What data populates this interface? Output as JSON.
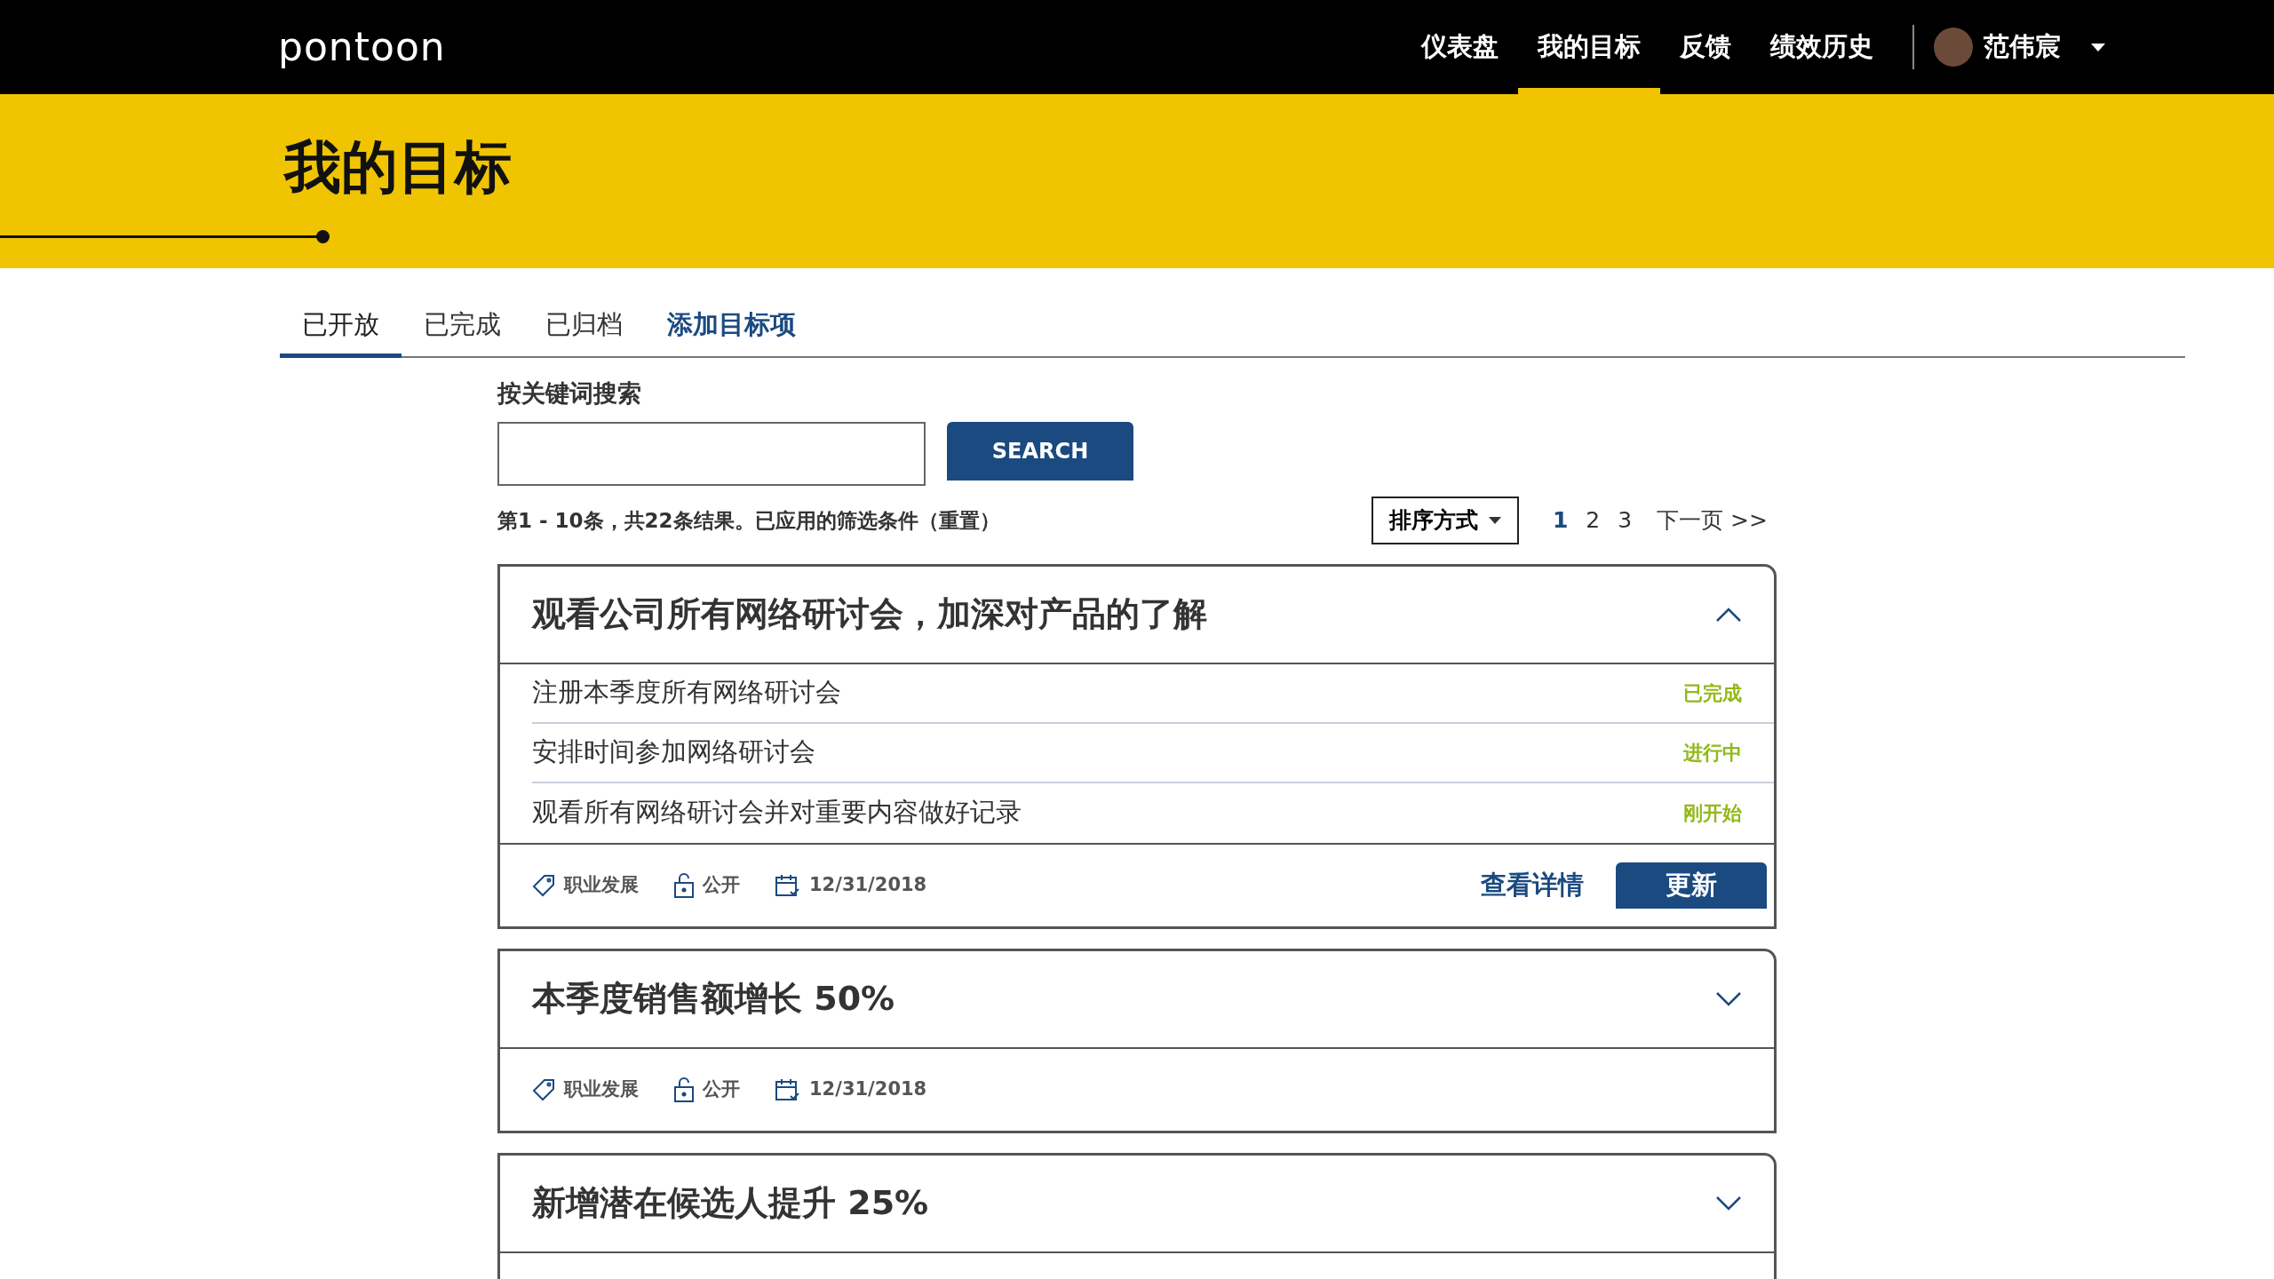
{
  "navbar": {
    "logo": "pontoon",
    "links": [
      {
        "label": "仪表盘",
        "selected": false
      },
      {
        "label": "我的目标",
        "selected": true
      },
      {
        "label": "反馈",
        "selected": false
      },
      {
        "label": "绩效历史",
        "selected": false
      }
    ],
    "user": {
      "name": "范伟宸"
    }
  },
  "page_title": "我的目标",
  "tabs": [
    {
      "label": "已开放",
      "selected": true,
      "kind": "tab"
    },
    {
      "label": "已完成",
      "selected": false,
      "kind": "tab"
    },
    {
      "label": "已归档",
      "selected": false,
      "kind": "tab"
    },
    {
      "label": "添加目标项",
      "selected": false,
      "kind": "action"
    }
  ],
  "search": {
    "label": "按关键词搜索",
    "button": "SEARCH"
  },
  "results_summary": "第1 - 10条，共22条结果。已应用的筛选条件（重置）",
  "sort": {
    "label": "排序方式"
  },
  "pagination": {
    "pages": [
      {
        "label": "1",
        "selected": true
      },
      {
        "label": "2",
        "selected": false
      },
      {
        "label": "3",
        "selected": false
      }
    ],
    "next": "下一页 >>"
  },
  "goals": [
    {
      "title": "观看公司所有网络研讨会，加深对产品的了解",
      "expanded": true,
      "subtasks": [
        {
          "title": "注册本季度所有网络研讨会",
          "status": "已完成"
        },
        {
          "title": "安排时间参加网络研讨会",
          "status": "进行中"
        },
        {
          "title": "观看所有网络研讨会并对重要内容做好记录",
          "status": "刚开始"
        }
      ],
      "meta": {
        "category": "职业发展",
        "visibility": "公开",
        "date": "12/31/2018"
      },
      "actions": {
        "details": "查看详情",
        "update": "更新"
      }
    },
    {
      "title": "本季度销售额增长 50%",
      "expanded": false,
      "meta": {
        "category": "职业发展",
        "visibility": "公开",
        "date": "12/31/2018"
      }
    },
    {
      "title": "新增潜在候选人提升 25%",
      "expanded": false
    }
  ]
}
